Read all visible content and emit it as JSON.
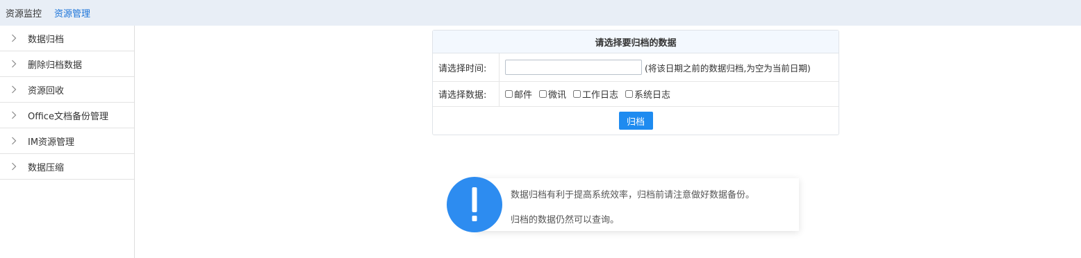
{
  "topbar": {
    "tabs": [
      {
        "label": "资源监控",
        "active": false
      },
      {
        "label": "资源管理",
        "active": true
      }
    ]
  },
  "sidebar": {
    "items": [
      {
        "label": "数据归档",
        "icon": "chevron-right-icon"
      },
      {
        "label": "删除归档数据",
        "icon": "chevron-right-icon"
      },
      {
        "label": "资源回收",
        "icon": "chevron-right-icon"
      },
      {
        "label": "Office文档备份管理",
        "icon": "chevron-right-icon"
      },
      {
        "label": "IM资源管理",
        "icon": "chevron-right-icon"
      },
      {
        "label": "数据压缩",
        "icon": "chevron-right-icon"
      }
    ]
  },
  "form": {
    "title": "请选择要归档的数据",
    "time_label": "请选择时间:",
    "time_value": "",
    "time_hint": "(将该日期之前的数据归档,为空为当前日期)",
    "data_label": "请选择数据:",
    "options": [
      {
        "label": "邮件",
        "checked": false
      },
      {
        "label": "微讯",
        "checked": false
      },
      {
        "label": "工作日志",
        "checked": false
      },
      {
        "label": "系统日志",
        "checked": false
      }
    ],
    "submit_label": "归档"
  },
  "notice": {
    "icon": "exclamation-icon",
    "line1": "数据归档有利于提高系统效率，归档前请注意做好数据备份。",
    "line2": "归档的数据仍然可以查询。"
  },
  "colors": {
    "accent": "#1e8bf0",
    "topbar_bg": "#e8eef6",
    "active_tab": "#1a73d9"
  }
}
